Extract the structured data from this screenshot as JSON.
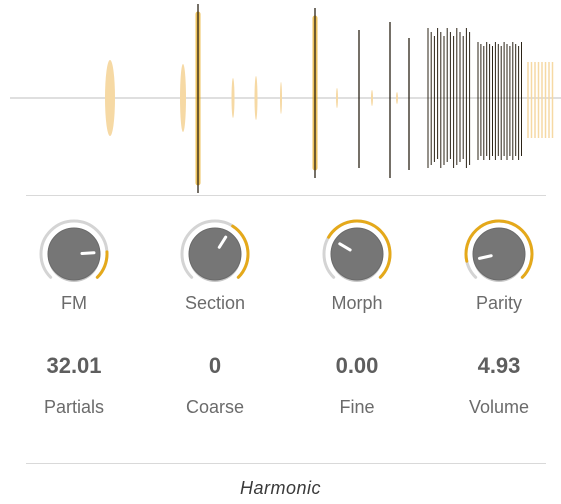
{
  "colors": {
    "accent": "#E5A91A",
    "track": "#D4D4D4",
    "knob_body": "#767676",
    "axis": "#BFBFBF",
    "wave_dark": "#2B2316",
    "wave_soft": "#F6D9A4"
  },
  "knobs": [
    {
      "label": "FM",
      "value_fraction": 0.82
    },
    {
      "label": "Section",
      "value_fraction": 0.62
    },
    {
      "label": "Morph",
      "value_fraction": 0.28
    },
    {
      "label": "Parity",
      "value_fraction": 0.12
    }
  ],
  "params": [
    {
      "value": "32.01",
      "label": "Partials"
    },
    {
      "value": "0",
      "label": "Coarse"
    },
    {
      "value": "0.00",
      "label": "Fine"
    },
    {
      "value": "4.93",
      "label": "Volume"
    }
  ],
  "footer": {
    "title": "Harmonic"
  }
}
